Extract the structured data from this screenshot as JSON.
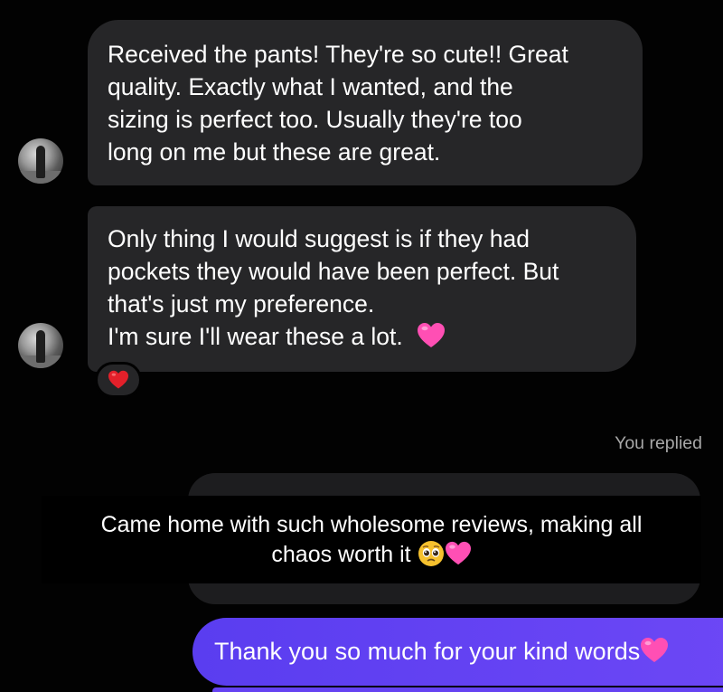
{
  "conversation": {
    "message_1": {
      "lines": [
        "Received the pants! They're so cute!! Great",
        "quality. Exactly what I wanted, and the",
        "sizing is perfect too. Usually they're too",
        "long on me but these are great."
      ]
    },
    "message_2": {
      "lines": [
        "Only thing I would suggest is if they had",
        "pockets they would have been perfect. But",
        "that's just my preference.",
        "I'm sure I'll wear these a lot."
      ],
      "emoji": "pink-heart"
    },
    "reaction": "red-heart",
    "replied_label": "You replied",
    "caption": {
      "line1": "Came home with such wholesome reviews, making all",
      "line2": "chaos worth it"
    },
    "outgoing_message": "Thank you so much for your kind words"
  },
  "colors": {
    "background": "#020202",
    "incoming_bubble": "#262628",
    "outgoing_bubble": "#6543f2",
    "pink_heart": "#ff4fb4",
    "red_heart": "#e3202a",
    "muted_text": "#a8a8a8"
  }
}
